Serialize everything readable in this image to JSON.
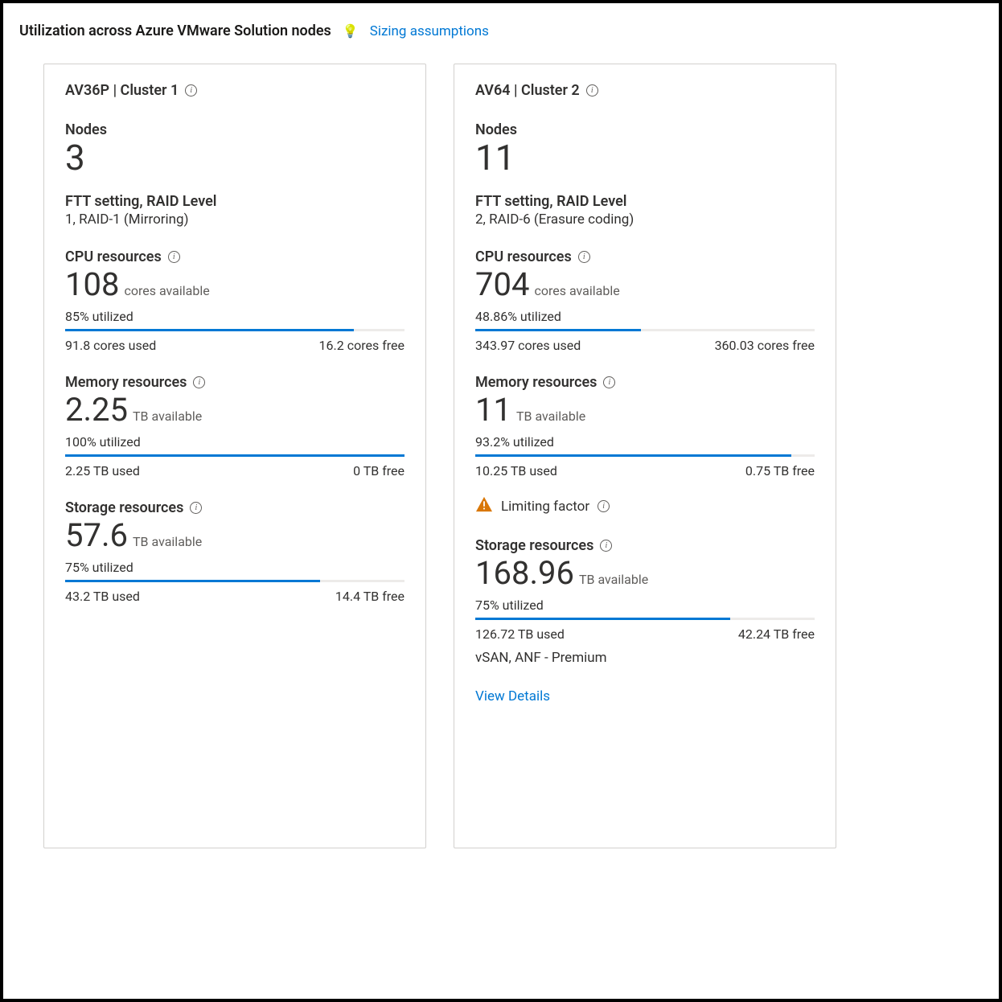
{
  "header": {
    "title": "Utilization across Azure VMware Solution nodes",
    "assumptions_link": "Sizing assumptions"
  },
  "clusters": [
    {
      "title": "AV36P | Cluster 1",
      "nodes_label": "Nodes",
      "nodes_value": "3",
      "ftt_label": "FTT setting, RAID Level",
      "ftt_value": "1, RAID-1 (Mirroring)",
      "cpu": {
        "label": "CPU resources",
        "value": "108",
        "unit": "cores available",
        "utilized": "85% utilized",
        "used": "91.8 cores used",
        "free": "16.2 cores free",
        "pct": 85
      },
      "memory": {
        "label": "Memory resources",
        "value": "2.25",
        "unit": "TB available",
        "utilized": "100% utilized",
        "used": "2.25 TB used",
        "free": "0 TB free",
        "pct": 100
      },
      "storage": {
        "label": "Storage resources",
        "value": "57.6",
        "unit": "TB available",
        "utilized": "75% utilized",
        "used": "43.2 TB used",
        "free": "14.4 TB free",
        "pct": 75
      }
    },
    {
      "title": "AV64 | Cluster 2",
      "nodes_label": "Nodes",
      "nodes_value": "11",
      "ftt_label": "FTT setting, RAID Level",
      "ftt_value": "2, RAID-6 (Erasure coding)",
      "cpu": {
        "label": "CPU resources",
        "value": "704",
        "unit": "cores available",
        "utilized": "48.86% utilized",
        "used": "343.97 cores used",
        "free": "360.03 cores free",
        "pct": 48.86
      },
      "memory": {
        "label": "Memory resources",
        "value": "11",
        "unit": "TB available",
        "utilized": "93.2% utilized",
        "used": "10.25 TB used",
        "free": "0.75 TB free",
        "pct": 93.2
      },
      "limiting_label": "Limiting factor",
      "storage": {
        "label": "Storage resources",
        "value": "168.96",
        "unit": "TB available",
        "utilized": "75% utilized",
        "used": "126.72 TB used",
        "free": "42.24 TB free",
        "pct": 75,
        "extra": "vSAN, ANF - Premium"
      },
      "view_details": "View Details"
    }
  ]
}
